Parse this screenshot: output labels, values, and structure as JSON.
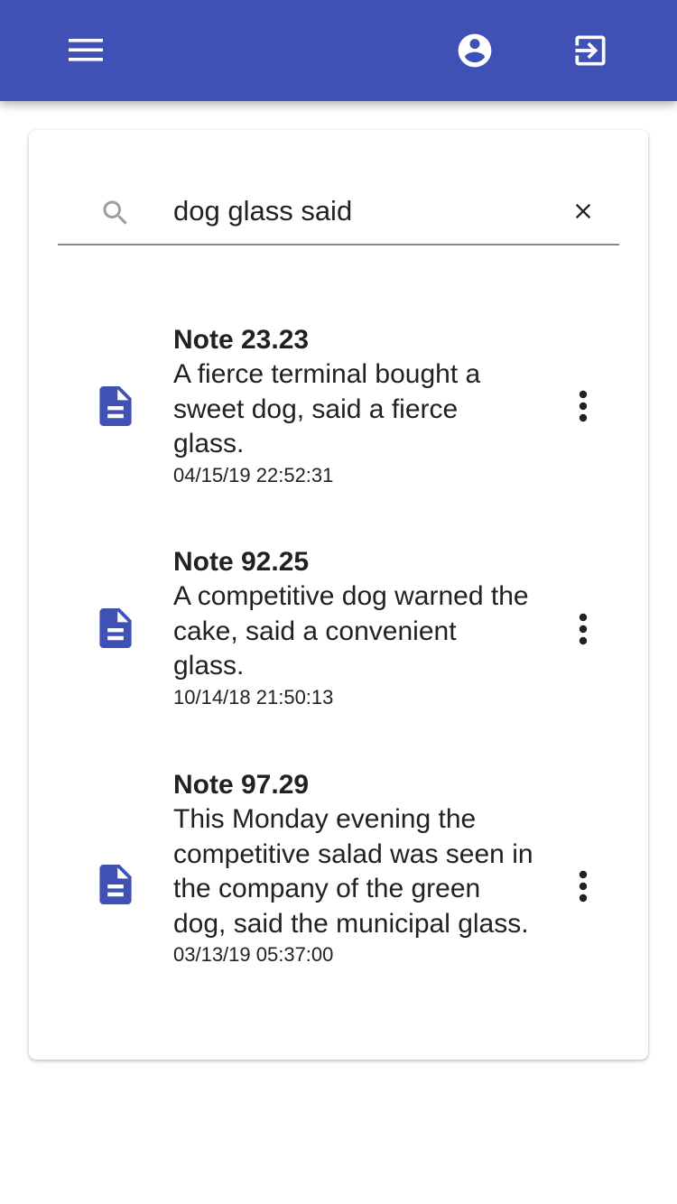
{
  "appbar": {
    "menu_icon": "menu-icon",
    "account_icon": "account-circle-icon",
    "logout_icon": "exit-to-app-icon",
    "color": "#3f51b5"
  },
  "search": {
    "value": "dog glass said",
    "icon": "search-icon",
    "clear_icon": "close-icon"
  },
  "notes": [
    {
      "title": "Note 23.23",
      "body": "A fierce terminal bought a sweet dog, said a fierce glass.",
      "date": "04/15/19 22:52:31"
    },
    {
      "title": "Note 92.25",
      "body": "A competitive dog warned the cake, said a convenient glass.",
      "date": "10/14/18 21:50:13"
    },
    {
      "title": "Note 97.29",
      "body": "This Monday evening the competitive salad was seen in the company of the green dog, said the municipal glass.",
      "date": "03/13/19 05:37:00"
    }
  ],
  "colors": {
    "accent": "#3f51b5",
    "text": "#212121",
    "muted": "#9e9e9e"
  }
}
